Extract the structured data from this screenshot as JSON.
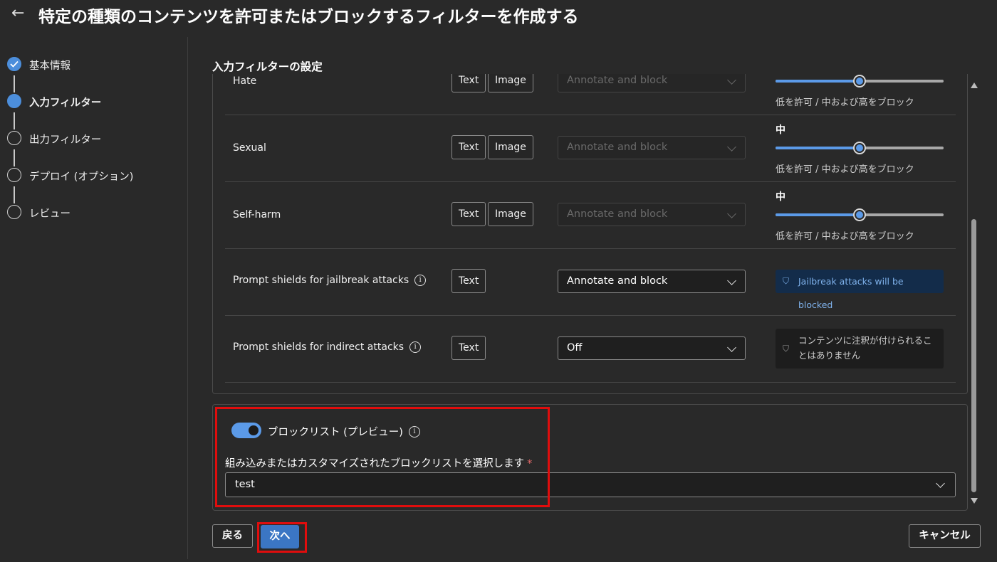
{
  "header": {
    "back_icon": "back-arrow-icon",
    "title": "特定の種類のコンテンツを許可またはブロックするフィルターを作成する"
  },
  "steps": [
    {
      "label": "基本情報",
      "state": "done"
    },
    {
      "label": "入力フィルター",
      "state": "active"
    },
    {
      "label": "出力フィルター",
      "state": "pending"
    },
    {
      "label": "デプロイ (オプション)",
      "state": "pending"
    },
    {
      "label": "レビュー",
      "state": "pending"
    }
  ],
  "section_title": "入力フィルターの設定",
  "filters": {
    "hate": {
      "label": "Hate",
      "chip_text": "Text",
      "chip_image": "Image",
      "action": "Annotate and block",
      "caption": "低を許可 / 中および高をブロック"
    },
    "sexual": {
      "label": "Sexual",
      "chip_text": "Text",
      "chip_image": "Image",
      "action": "Annotate and block",
      "level": "中",
      "caption": "低を許可 / 中および高をブロック"
    },
    "self_harm": {
      "label": "Self-harm",
      "chip_text": "Text",
      "chip_image": "Image",
      "action": "Annotate and block",
      "level": "中",
      "caption": "低を許可 / 中および高をブロック"
    },
    "jailbreak": {
      "label": "Prompt shields for jailbreak attacks",
      "chip_text": "Text",
      "action": "Annotate and block",
      "status": "Jailbreak attacks will be blocked"
    },
    "indirect": {
      "label": "Prompt shields for indirect attacks",
      "chip_text": "Text",
      "action": "Off",
      "status": "コンテンツに注釈が付けられることはありません"
    }
  },
  "slider_fraction": 0.5,
  "blocklist": {
    "toggle_on": true,
    "toggle_label": "ブロックリスト (プレビュー)",
    "field_label": "組み込みまたはカスタマイズされたブロックリストを選択します",
    "required_mark": "*",
    "selected": "test"
  },
  "footer": {
    "back_label": "戻る",
    "next_label": "次へ",
    "cancel_label": "キャンセル"
  },
  "colors": {
    "accent": "#5b9ae8",
    "primary_button": "#3b76c4",
    "highlight": "#e00d0d",
    "background": "#292929"
  }
}
